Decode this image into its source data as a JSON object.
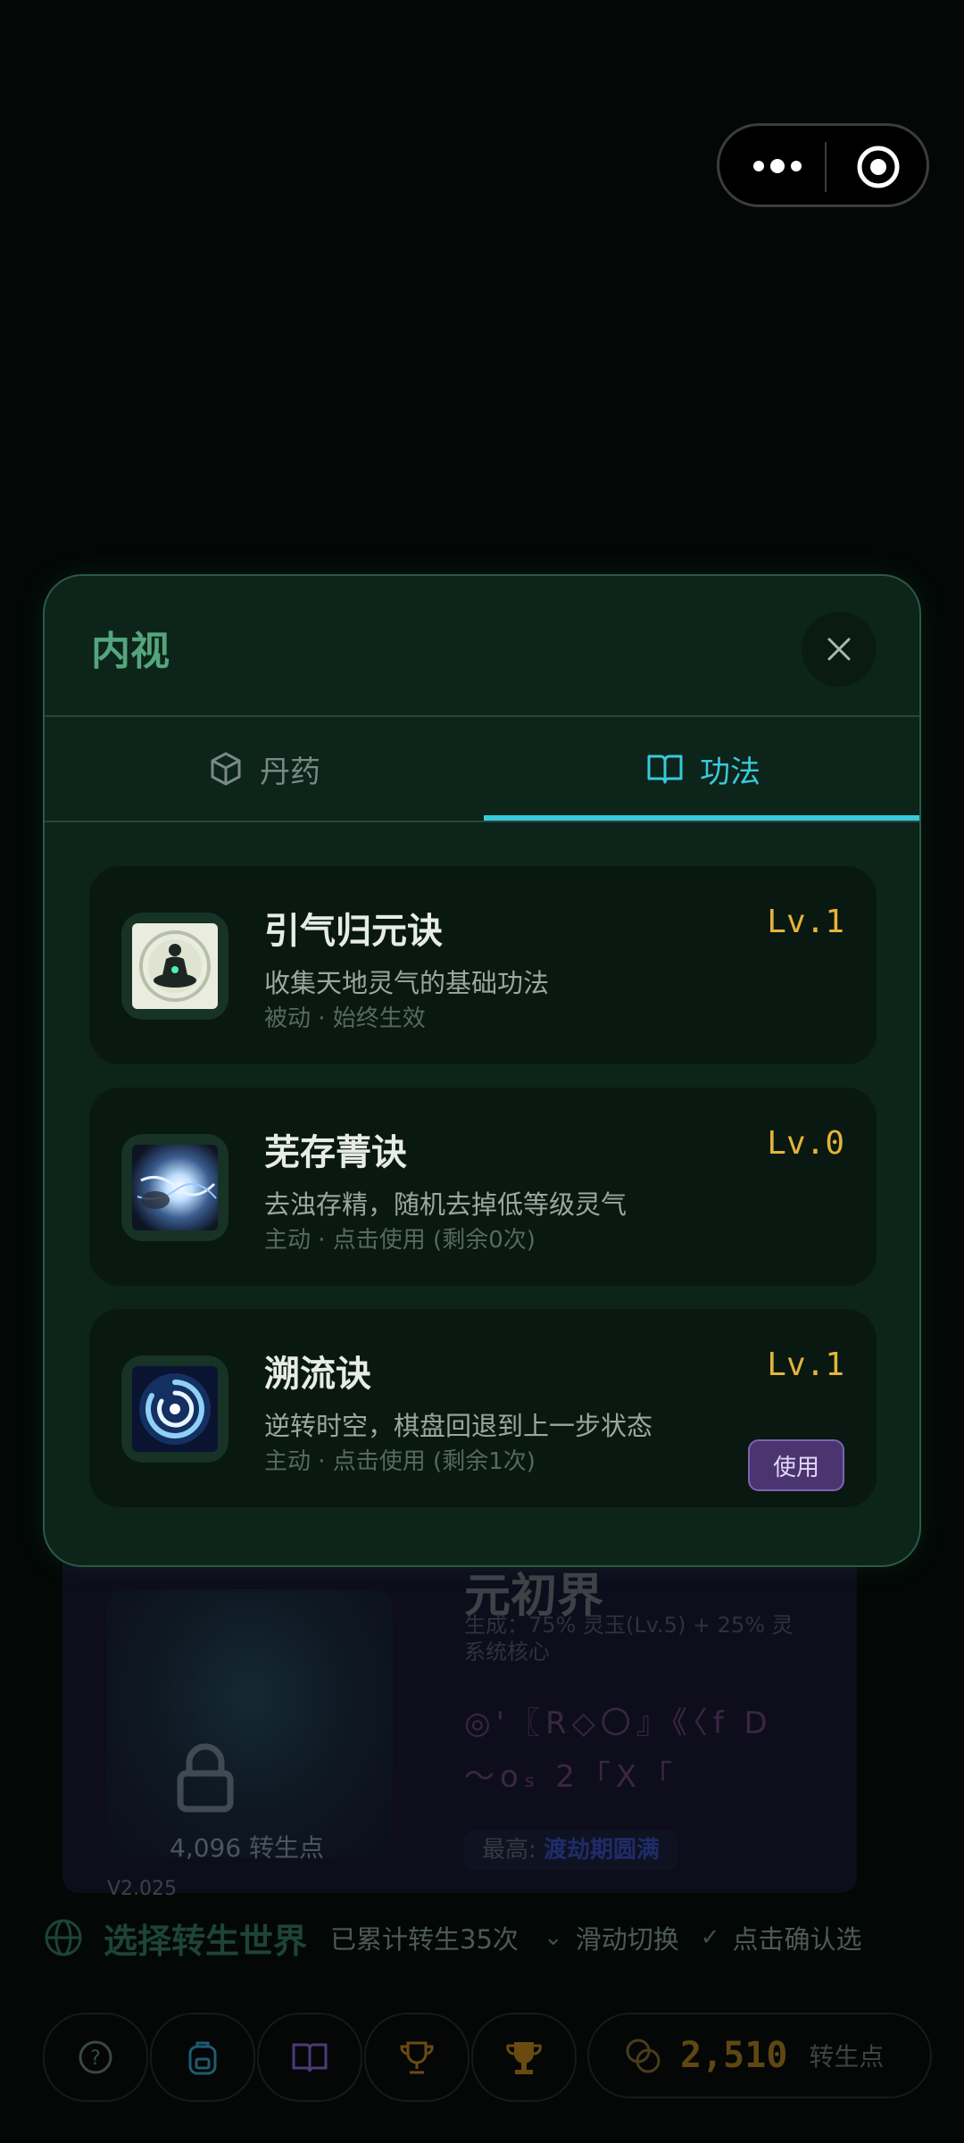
{
  "capsule": {
    "more_icon": "more-dots-icon",
    "target_icon": "target-icon"
  },
  "modal": {
    "title": "内视",
    "close_icon": "close-icon",
    "tabs": [
      {
        "label": "丹药",
        "icon": "cube-icon",
        "active": false
      },
      {
        "label": "功法",
        "icon": "book-icon",
        "active": true
      }
    ],
    "skills": [
      {
        "name": "引气归元诀",
        "level": "Lv.1",
        "desc": "收集天地灵气的基础功法",
        "meta": "被动 · 始终生效",
        "icon": "meditation-icon"
      },
      {
        "name": "芜存菁诀",
        "level": "Lv.0",
        "desc": "去浊存精，随机去掉低等级灵气",
        "meta": "主动 · 点击使用 (剩余0次)",
        "icon": "energy-burst-icon"
      },
      {
        "name": "溯流诀",
        "level": "Lv.1",
        "desc": "逆转时空，棋盘回退到上一步状态",
        "meta": "主动 · 点击使用 (剩余1次)",
        "icon": "vortex-icon",
        "action": "使用"
      }
    ]
  },
  "background": {
    "world_name": "元初界",
    "world_sub": "生成：75% 灵玉(Lv.5) + 25% 灵 系统核心",
    "rune_text": "◎'〖R◇〇』《〈f D～oₛ 2「X「",
    "lock_cost": "4,096 转生点",
    "best_label": "最高:",
    "best_value": "渡劫期圆满",
    "version": "V2.025",
    "selector_title": "选择转生世界",
    "rebirth_count": "已累计转生35次",
    "hint_swipe": "滑动切换",
    "hint_confirm": "点击确认选",
    "points_value": "2,510",
    "points_unit": "转生点",
    "bottom_icons": [
      "help-icon",
      "backpack-icon",
      "book-icon",
      "trophy-icon",
      "trophy-icon"
    ],
    "colors": {
      "accent_cyan": "#38c9dc",
      "level_gold": "#e4b43a",
      "use_purple": "#4a3570"
    }
  }
}
